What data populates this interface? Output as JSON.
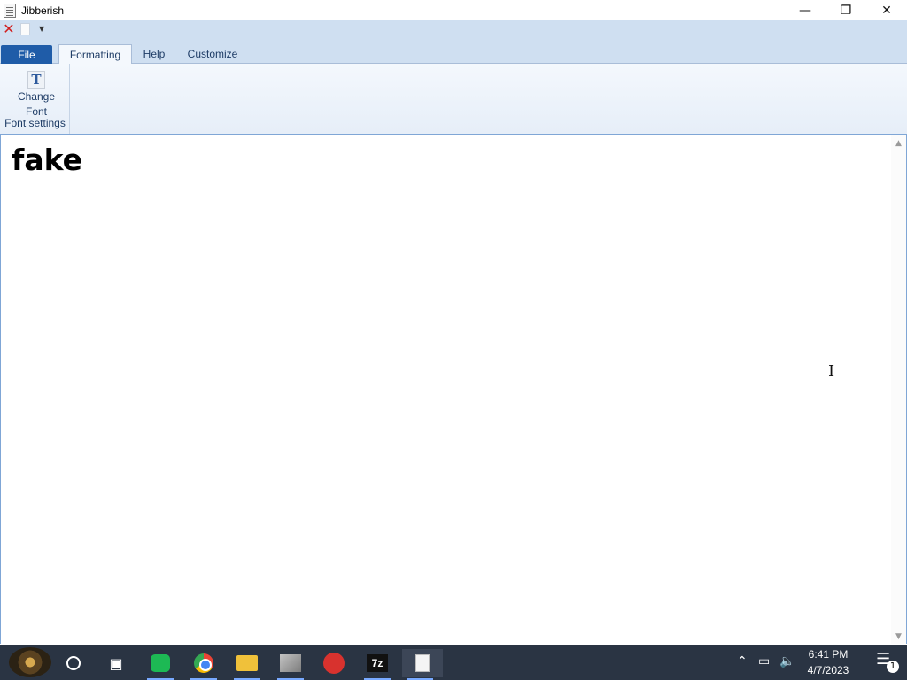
{
  "window": {
    "title": "Jibberish",
    "controls": [
      "minimize",
      "restore",
      "close"
    ]
  },
  "quick_access": {
    "items": [
      "close-icon",
      "new-document-icon",
      "dropdown-arrow-icon"
    ]
  },
  "ribbon": {
    "tabs": [
      {
        "label": "File"
      },
      {
        "label": "Formatting"
      },
      {
        "label": "Help"
      },
      {
        "label": "Customize"
      }
    ],
    "groups": [
      {
        "label": "Font settings",
        "buttons": [
          {
            "label_line1": "Change",
            "label_line2": "Font",
            "icon": "font-icon"
          }
        ]
      }
    ]
  },
  "editor": {
    "text": "fake"
  },
  "taskbar": {
    "apps": [
      "start-button",
      "search-icon",
      "task-view-icon",
      "chat-icon",
      "chrome-icon",
      "file-explorer-icon",
      "photo-viewer-icon",
      "red-app-icon",
      "7zip-icon",
      "jibberish-taskbar-icon"
    ],
    "seven_zip_label": "7z",
    "time": "6:41 PM",
    "date": "4/7/2023",
    "notification_count": "1"
  }
}
